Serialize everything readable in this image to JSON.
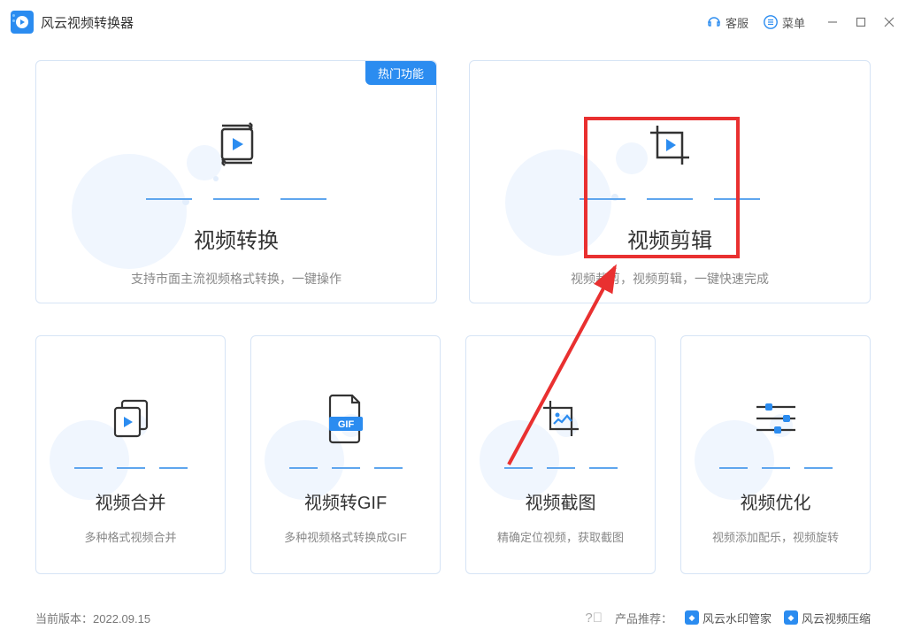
{
  "titlebar": {
    "app_title": "风云视频转换器",
    "customer_service": "客服",
    "menu": "菜单"
  },
  "cards": {
    "convert": {
      "title": "视频转换",
      "desc": "支持市面主流视频格式转换，一键操作",
      "badge": "热门功能"
    },
    "edit": {
      "title": "视频剪辑",
      "desc": "视频裁剪，视频剪辑，一键快速完成"
    },
    "merge": {
      "title": "视频合并",
      "desc": "多种格式视频合并"
    },
    "gif": {
      "title": "视频转GIF",
      "desc": "多种视频格式转换成GIF",
      "icon_text": "GIF"
    },
    "screenshot": {
      "title": "视频截图",
      "desc": "精确定位视频，获取截图"
    },
    "optimize": {
      "title": "视频优化",
      "desc": "视频添加配乐，视频旋转"
    }
  },
  "footer": {
    "version_label": "当前版本：",
    "version": "2022.09.15",
    "recommend_label": "产品推荐：",
    "link1": "风云水印管家",
    "link2": "风云视频压缩"
  }
}
